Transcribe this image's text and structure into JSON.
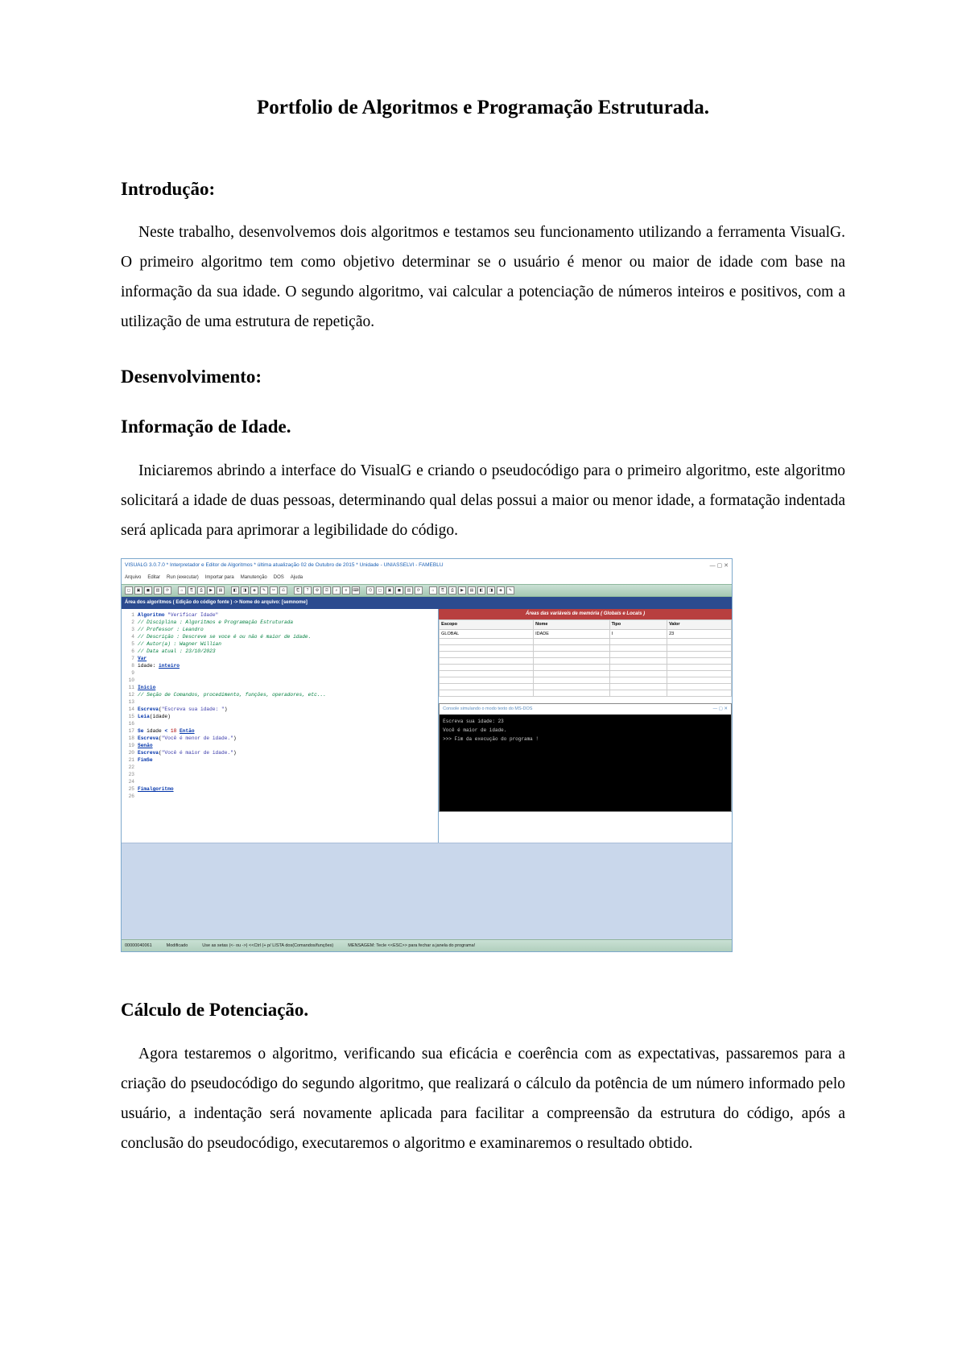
{
  "title": "Portfolio de Algoritmos e Programação Estruturada.",
  "intro_heading": "Introdução:",
  "intro_body": "Neste trabalho, desenvolvemos dois algoritmos e testamos seu funcionamento utilizando a ferramenta VisualG. O primeiro algoritmo tem como objetivo determinar se o usuário é menor ou maior de idade com base na informação da sua idade. O segundo algoritmo, vai calcular a potenciação de números inteiros e positivos, com a utilização de uma estrutura de repetição.",
  "dev_heading": "Desenvolvimento:",
  "info_idade_heading": "Informação de Idade.",
  "info_idade_body": "Iniciaremos abrindo a interface do VisualG e criando o pseudocódigo para o primeiro algoritmo, este algoritmo solicitará a idade de duas pessoas, determinando qual delas possui a maior ou menor idade, a formatação indentada será aplicada para aprimorar a legibilidade do código.",
  "calc_heading": "Cálculo de Potenciação.",
  "calc_body": "Agora testaremos o algoritmo, verificando sua eficácia e coerência com as expectativas, passaremos para a criação do pseudocódigo do segundo algoritmo, que realizará o cálculo da potência de um número informado pelo usuário, a indentação será novamente aplicada para facilitar a compreensão da estrutura do código, após a conclusão do pseudocódigo, executaremos o algoritmo e examinaremos o resultado obtido.",
  "visualg": {
    "titlebar": "VISUALG 3.0.7.0 * Interpretador e Editor de Algoritmos * última atualização 02 de Outubro de 2015 * Unidade - UNIASSELVI - FAMEBLU",
    "window_buttons": "—  ▢  ✕",
    "menu": [
      "Arquivo",
      "Editar",
      "Run (executar)",
      "Importar para",
      "Manutenção",
      "DOS",
      "Ajuda"
    ],
    "algobar": "Área dos algoritmos ( Edição do código fonte ) -> Nome do arquivo: [semnome]",
    "vars_header": "Áreas das variáveis de memória ( Globais e Locais )",
    "vars_cols": [
      "Escopo",
      "Nome",
      "Tipo",
      "Valor"
    ],
    "vars_rows": [
      [
        "GLOBAL",
        "IDADE",
        "I",
        "23"
      ]
    ],
    "console_title": "Console simulando o modo texto do MS-DOS",
    "console_btns": "—  ▢  ✕",
    "console_out": "Escreva sua idade: 23\nVocê é maior de idade.\n>>> Fim da execução do programa !",
    "status": {
      "pos": "00000040061",
      "mode": "Modificado",
      "hint": "Use as setas (<- ou ->) <<Ctrl (+ p/ LISTA dos(Comandos/funções)",
      "msg": "MENSAGEM: Tecle <<ESC>> para fechar a janela do programa!"
    },
    "code": [
      {
        "n": "1",
        "frag": [
          {
            "c": "kw",
            "t": "Algoritmo "
          },
          {
            "c": "str",
            "t": "\"Verificar Idade\""
          }
        ]
      },
      {
        "n": "2",
        "frag": [
          {
            "c": "com",
            "t": "// Disciplina   : Algoritmos e Programação Estruturada"
          }
        ]
      },
      {
        "n": "3",
        "frag": [
          {
            "c": "com",
            "t": "// Professor    : Leandro"
          }
        ]
      },
      {
        "n": "4",
        "frag": [
          {
            "c": "com",
            "t": "// Descrição   : Descreve se voce é ou não é maior de idade."
          }
        ]
      },
      {
        "n": "5",
        "frag": [
          {
            "c": "com",
            "t": "// Autor(a)    : Wagner Willian"
          }
        ]
      },
      {
        "n": "6",
        "frag": [
          {
            "c": "com",
            "t": "// Data atual  : 23/10/2023"
          }
        ]
      },
      {
        "n": "7",
        "frag": [
          {
            "c": "kwu",
            "t": "Var"
          }
        ]
      },
      {
        "n": "8",
        "frag": [
          {
            "c": "",
            "t": " idade: "
          },
          {
            "c": "kwu",
            "t": "inteiro"
          }
        ]
      },
      {
        "n": "9",
        "frag": [
          {
            "c": "",
            "t": ""
          }
        ]
      },
      {
        "n": "10",
        "frag": [
          {
            "c": "",
            "t": ""
          }
        ]
      },
      {
        "n": "11",
        "frag": [
          {
            "c": "kwu",
            "t": "Inicio"
          }
        ]
      },
      {
        "n": "12",
        "frag": [
          {
            "c": "com",
            "t": "// Seção de Comandos, procedimento, funções, operadores, etc..."
          }
        ]
      },
      {
        "n": "13",
        "frag": [
          {
            "c": "",
            "t": ""
          }
        ]
      },
      {
        "n": "14",
        "frag": [
          {
            "c": "",
            "t": "    "
          },
          {
            "c": "kw",
            "t": "Escreva"
          },
          {
            "c": "",
            "t": "("
          },
          {
            "c": "str",
            "t": "\"Escreva sua idade: \""
          },
          {
            "c": "",
            "t": ")"
          }
        ]
      },
      {
        "n": "15",
        "frag": [
          {
            "c": "",
            "t": "    "
          },
          {
            "c": "kw",
            "t": "Leia"
          },
          {
            "c": "",
            "t": "(idade)"
          }
        ]
      },
      {
        "n": "16",
        "frag": [
          {
            "c": "",
            "t": ""
          }
        ]
      },
      {
        "n": "17",
        "frag": [
          {
            "c": "",
            "t": "    "
          },
          {
            "c": "kw",
            "t": "Se"
          },
          {
            "c": "",
            "t": " idade "
          },
          {
            "c": "kw",
            "t": "<"
          },
          {
            "c": "",
            "t": " "
          },
          {
            "c": "num",
            "t": "18"
          },
          {
            "c": "",
            "t": " "
          },
          {
            "c": "kwu",
            "t": "Então"
          }
        ]
      },
      {
        "n": "18",
        "frag": [
          {
            "c": "",
            "t": "       "
          },
          {
            "c": "kw",
            "t": "Escreva"
          },
          {
            "c": "",
            "t": "("
          },
          {
            "c": "str",
            "t": "\"Você é menor de idade.\""
          },
          {
            "c": "",
            "t": ")"
          }
        ]
      },
      {
        "n": "19",
        "frag": [
          {
            "c": "",
            "t": "    "
          },
          {
            "c": "kwu",
            "t": "Senão"
          }
        ]
      },
      {
        "n": "20",
        "frag": [
          {
            "c": "",
            "t": "       "
          },
          {
            "c": "kw",
            "t": "Escreva"
          },
          {
            "c": "",
            "t": "("
          },
          {
            "c": "str",
            "t": "\"Você é maior de idade.\""
          },
          {
            "c": "",
            "t": ")"
          }
        ]
      },
      {
        "n": "21",
        "frag": [
          {
            "c": "",
            "t": "    "
          },
          {
            "c": "kw",
            "t": "FimSe"
          }
        ]
      },
      {
        "n": "22",
        "frag": [
          {
            "c": "",
            "t": ""
          }
        ]
      },
      {
        "n": "23",
        "frag": [
          {
            "c": "",
            "t": ""
          }
        ]
      },
      {
        "n": "24",
        "frag": [
          {
            "c": "",
            "t": ""
          }
        ]
      },
      {
        "n": "25",
        "frag": [
          {
            "c": "kwu",
            "t": "Fimalgoritmo"
          }
        ]
      },
      {
        "n": "26",
        "frag": [
          {
            "c": "",
            "t": ""
          }
        ]
      }
    ]
  }
}
